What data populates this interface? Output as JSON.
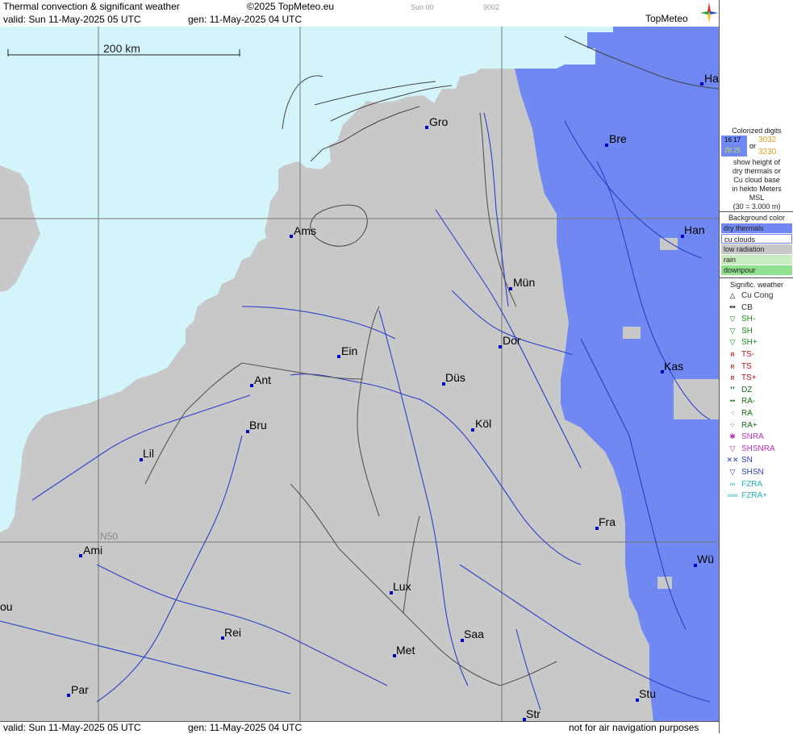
{
  "header": {
    "title": "Thermal convection & significant weather",
    "copyright": "©2025 TopMeteo.eu",
    "valid": "valid:  Sun  11-May-2025  05 UTC",
    "generated": "gen: 11-May-2025 04 UTC",
    "code1": "Sun 00",
    "code2": "9002",
    "logo": "TopMeteo"
  },
  "map": {
    "scale_label": "200 km",
    "lat_label": "N50",
    "colors": {
      "sea": "#d2f4fa",
      "land": "#c8c8c8",
      "dry": "#6f88f2",
      "river": "#2b3fc8",
      "border": "#555555",
      "grid": "#777777",
      "city": "#0000cc"
    },
    "cities": [
      {
        "name": "Gro"
      },
      {
        "name": "Bre"
      },
      {
        "name": "Ha"
      },
      {
        "name": "Ams"
      },
      {
        "name": "Han"
      },
      {
        "name": "Mün"
      },
      {
        "name": "Dor"
      },
      {
        "name": "Ein"
      },
      {
        "name": "Kas"
      },
      {
        "name": "Ant"
      },
      {
        "name": "Düs"
      },
      {
        "name": "Köl"
      },
      {
        "name": "Bru"
      },
      {
        "name": "Lil"
      },
      {
        "name": "Fra"
      },
      {
        "name": "Ami"
      },
      {
        "name": "Wü"
      },
      {
        "name": "Lux"
      },
      {
        "name": "ou"
      },
      {
        "name": "Rei"
      },
      {
        "name": "Saa"
      },
      {
        "name": "Met"
      },
      {
        "name": "Stu"
      },
      {
        "name": "Par"
      },
      {
        "name": "Str"
      }
    ]
  },
  "footer": {
    "valid": "valid:  Sun  11-May-2025  05 UTC",
    "generated": "gen: 11-May-2025 04 UTC",
    "note": "not for air navigation purposes"
  },
  "legend": {
    "colorized_title": "Colorized digits",
    "digits_a": "16 17",
    "digits_b": "28 25",
    "or": "or",
    "digits_c": "3032",
    "digits_d": "3230",
    "desc1": "show height of",
    "desc2": "dry thermals or",
    "desc3": "Cu cloud base",
    "desc4": "in hekto Meters",
    "desc5": "MSL",
    "desc6": "(30 = 3.000 m)",
    "bg_title": "Background color",
    "bg_items": [
      {
        "label": "dry thermals",
        "color": "#6f88f2"
      },
      {
        "label": "cu clouds",
        "color": "#ffffff"
      },
      {
        "label": "low radiation",
        "color": "#c8c8c8"
      },
      {
        "label": "rain",
        "color": "#c8ecc0"
      },
      {
        "label": "downpour",
        "color": "#8fe08f"
      }
    ],
    "wx_title": "Signific. weather",
    "wx_items": [
      {
        "label": "Cu Cong",
        "symbol": "△",
        "color": "#000"
      },
      {
        "label": "CB",
        "symbol": "⏛",
        "color": "#000"
      },
      {
        "label": "SH-",
        "symbol": "▽",
        "color": "#1a8a1a"
      },
      {
        "label": "SH",
        "symbol": "▽",
        "color": "#1a8a1a"
      },
      {
        "label": "SH+",
        "symbol": "▽",
        "color": "#1a8a1a"
      },
      {
        "label": "TS-",
        "symbol": "ʀ",
        "color": "#c01010"
      },
      {
        "label": "TS",
        "symbol": "ʀ",
        "color": "#c01010"
      },
      {
        "label": "TS+",
        "symbol": "ʀ",
        "color": "#c01010"
      },
      {
        "label": "DZ",
        "symbol": "❜❜",
        "color": "#1a6a1a"
      },
      {
        "label": "RA-",
        "symbol": "••",
        "color": "#1a6a1a"
      },
      {
        "label": "RA",
        "symbol": "⁖",
        "color": "#1a6a1a"
      },
      {
        "label": "RA+",
        "symbol": "⁘",
        "color": "#1a6a1a"
      },
      {
        "label": "SNRA",
        "symbol": "✱",
        "color": "#c030c0"
      },
      {
        "label": "SHSNRA",
        "symbol": "▽",
        "color": "#c030c0"
      },
      {
        "label": "SN",
        "symbol": "✕✕",
        "color": "#3040c0"
      },
      {
        "label": "SHSN",
        "symbol": "▽",
        "color": "#3040c0"
      },
      {
        "label": "FZRA",
        "symbol": "∞",
        "color": "#20b0c0"
      },
      {
        "label": "FZRA+",
        "symbol": "∞∞",
        "color": "#20b0c0"
      }
    ]
  }
}
